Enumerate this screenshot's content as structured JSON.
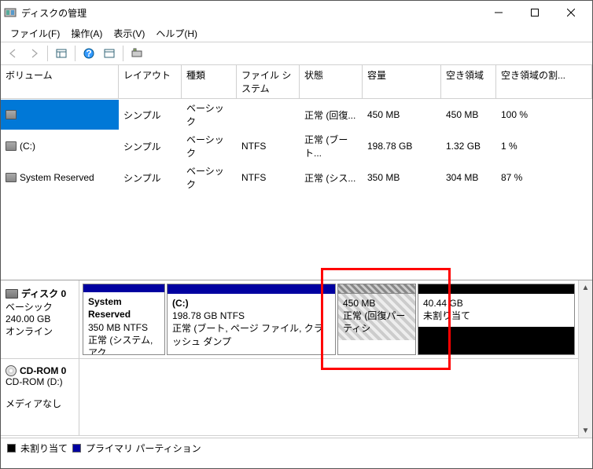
{
  "window": {
    "title": "ディスクの管理"
  },
  "menu": {
    "file": "ファイル(F)",
    "action": "操作(A)",
    "view": "表示(V)",
    "help": "ヘルプ(H)"
  },
  "columns": {
    "volume": "ボリューム",
    "layout": "レイアウト",
    "type": "種類",
    "filesystem": "ファイル システム",
    "status": "状態",
    "capacity": "容量",
    "free": "空き領域",
    "freepct": "空き領域の割..."
  },
  "volumes": [
    {
      "name": "",
      "layout": "シンプル",
      "type": "ベーシック",
      "fs": "",
      "status": "正常 (回復...",
      "capacity": "450 MB",
      "free": "450 MB",
      "pct": "100 %",
      "selected": true
    },
    {
      "name": "(C:)",
      "layout": "シンプル",
      "type": "ベーシック",
      "fs": "NTFS",
      "status": "正常 (ブート...",
      "capacity": "198.78 GB",
      "free": "1.32 GB",
      "pct": "1 %",
      "selected": false
    },
    {
      "name": "System Reserved",
      "layout": "シンプル",
      "type": "ベーシック",
      "fs": "NTFS",
      "status": "正常 (シス...",
      "capacity": "350 MB",
      "free": "304 MB",
      "pct": "87 %",
      "selected": false
    }
  ],
  "disks": {
    "disk0": {
      "label": "ディスク 0",
      "type": "ベーシック",
      "size": "240.00 GB",
      "status": "オンライン",
      "partitions": [
        {
          "name": "System Reserved",
          "size": "350 MB NTFS",
          "status": "正常 (システム, アク"
        },
        {
          "name": "(C:)",
          "size": "198.78 GB NTFS",
          "status": "正常 (ブート, ページ ファイル, クラッシュ ダンプ"
        },
        {
          "name": "",
          "size": "450 MB",
          "status": "正常 (回復パーティシ"
        },
        {
          "name": "",
          "size": "40.44 GB",
          "status": "未割り当て"
        }
      ]
    },
    "cdrom": {
      "label": "CD-ROM 0",
      "drive": "CD-ROM (D:)",
      "status": "メディアなし"
    }
  },
  "legend": {
    "unallocated": "未割り当て",
    "primary": "プライマリ パーティション"
  }
}
